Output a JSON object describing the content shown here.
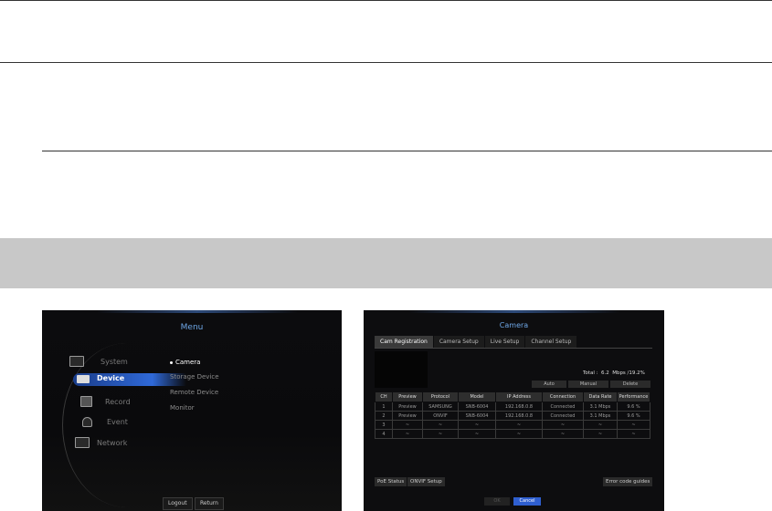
{
  "menu": {
    "title": "Menu",
    "items": [
      {
        "label": "System",
        "icon": "monitor-icon"
      },
      {
        "label": "Device",
        "icon": "camera-icon",
        "active": true
      },
      {
        "label": "Record",
        "icon": "record-icon"
      },
      {
        "label": "Event",
        "icon": "event-icon"
      },
      {
        "label": "Network",
        "icon": "network-icon"
      }
    ],
    "submenu": [
      "Camera",
      "Storage Device",
      "Remote Device",
      "Monitor"
    ],
    "buttons": {
      "logout": "Logout",
      "return": "Return"
    }
  },
  "camera": {
    "title": "Camera",
    "tabs": [
      "Cam Registration",
      "Camera Setup",
      "Live Setup",
      "Channel Setup"
    ],
    "total_label": "Total :",
    "total_value": "6.2",
    "total_unit": "Mbps /19.2%",
    "actions": {
      "auto": "Auto",
      "manual": "Manual",
      "delete": "Delete"
    },
    "columns": [
      "CH",
      "Preview",
      "Protocol",
      "Model",
      "IP Address",
      "Connection",
      "Data Rate",
      "Performance"
    ],
    "rows": [
      [
        "1",
        "Preview",
        "SAMSUNG",
        "SNB-6004",
        "192.168.0.8",
        "Connected",
        "3.1 Mbps",
        "9.6 %"
      ],
      [
        "2",
        "Preview",
        "ONVIF",
        "SNB-6004",
        "192.168.0.8",
        "Connected",
        "3.1 Mbps",
        "9.6 %"
      ],
      [
        "3",
        "~",
        "~",
        "~",
        "~",
        "~",
        "~",
        "~"
      ],
      [
        "4",
        "~",
        "~",
        "~",
        "~",
        "~",
        "~",
        "~"
      ]
    ],
    "bottom": {
      "poe": "PoE Status",
      "onvif": "ONVIF Setup",
      "error": "Error code guides"
    },
    "ok": "OK",
    "cancel": "Cancel"
  }
}
